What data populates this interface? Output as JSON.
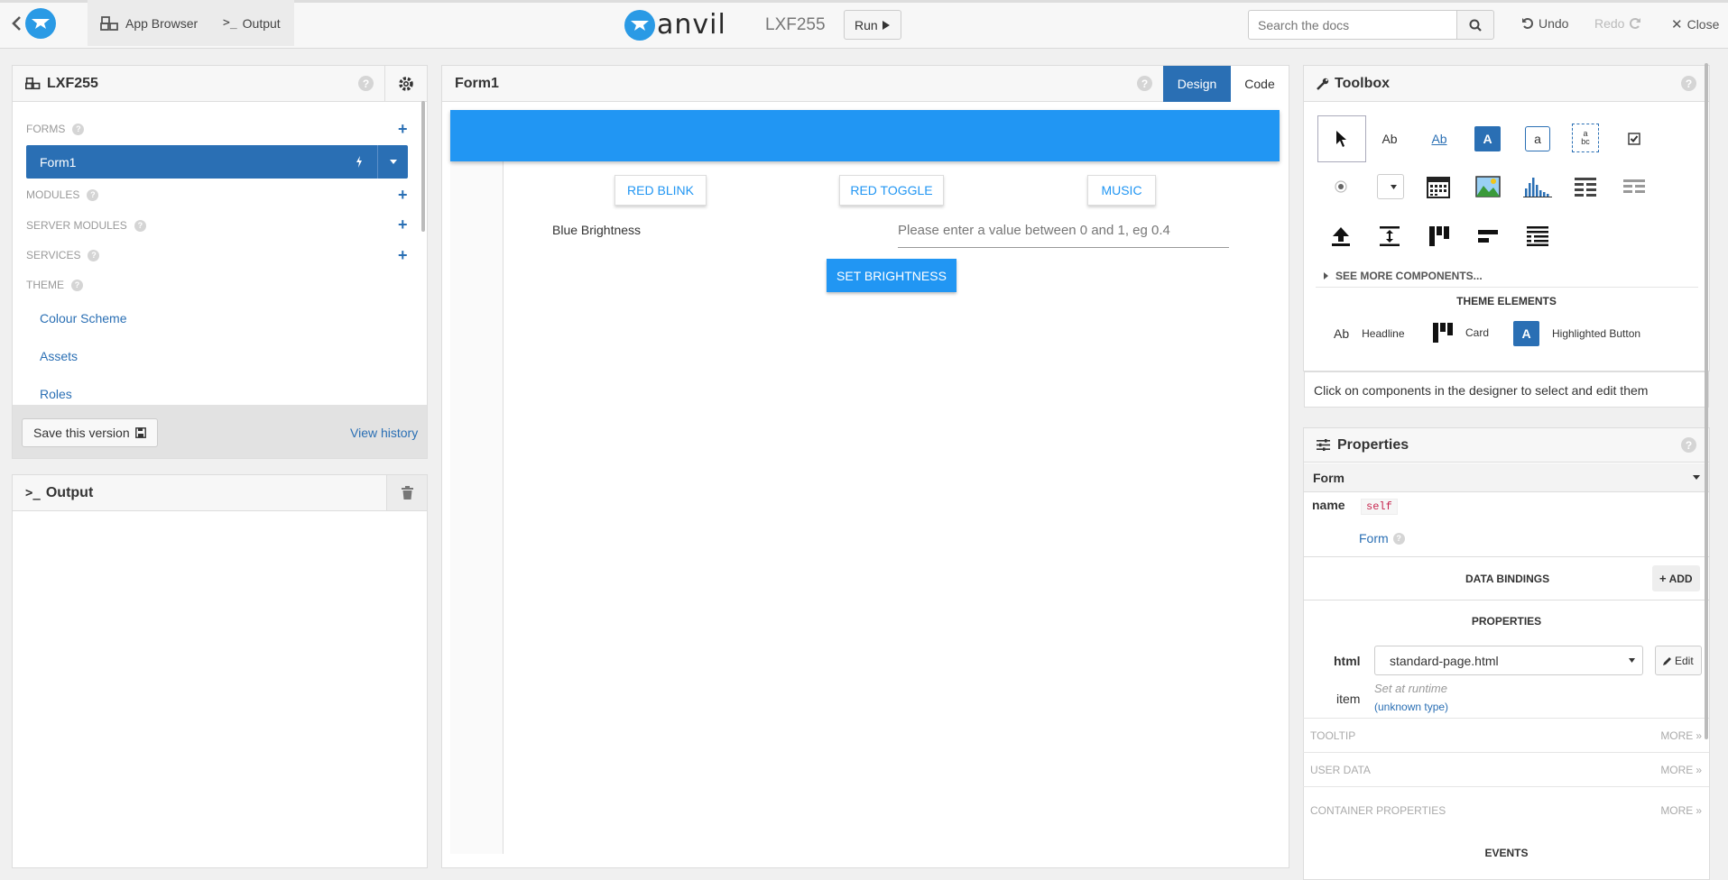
{
  "topbar": {
    "app_browser": "App Browser",
    "output": "Output",
    "brand": "anvil",
    "app_name": "LXF255",
    "run": "Run",
    "search_placeholder": "Search the docs",
    "undo": "Undo",
    "redo": "Redo",
    "close": "Close"
  },
  "app_panel": {
    "title": "LXF255",
    "sections": {
      "forms": "FORMS",
      "modules": "MODULES",
      "server_modules": "SERVER MODULES",
      "services": "SERVICES",
      "theme": "THEME"
    },
    "form_item": "Form1",
    "theme_items": [
      "Colour Scheme",
      "Assets",
      "Roles"
    ],
    "save_version": "Save this version",
    "view_history": "View history"
  },
  "output_panel": {
    "title": "Output"
  },
  "designer": {
    "title": "Form1",
    "tab_design": "Design",
    "tab_code": "Code",
    "buttons": [
      "RED BLINK",
      "RED TOGGLE",
      "MUSIC"
    ],
    "label": "Blue Brightness",
    "input_placeholder": "Please enter a value between 0 and 1, eg 0.4",
    "set_button": "SET BRIGHTNESS",
    "header_color": "#2196f3"
  },
  "toolbox": {
    "title": "Toolbox",
    "see_more": "SEE MORE COMPONENTS...",
    "theme_elements": "THEME ELEMENTS",
    "theme_items": [
      "Headline",
      "Card",
      "Highlighted Button"
    ],
    "hint": "Click on components in the designer to select and edit them",
    "tool_text": {
      "label": "Ab",
      "link": "Ab",
      "button": "A",
      "textbox": "a",
      "textarea_top": "a",
      "textarea_bottom": "bc",
      "headline_icon": "Ab",
      "hbutton_icon": "A"
    }
  },
  "properties": {
    "title": "Properties",
    "dropdown": "Form",
    "name_label": "name",
    "name_value": "self",
    "form_link": "Form",
    "data_bindings": "DATA BINDINGS",
    "add": "ADD",
    "properties_header": "PROPERTIES",
    "html_label": "html",
    "html_value": "standard-page.html",
    "edit": "Edit",
    "item_label": "item",
    "item_value": "Set at runtime",
    "item_type": "(unknown type)",
    "tooltip": "TOOLTIP",
    "user_data": "USER DATA",
    "container_properties": "CONTAINER PROPERTIES",
    "more": "MORE",
    "events": "EVENTS"
  },
  "colors": {
    "accent": "#2a6fb4",
    "material_blue": "#2196f3"
  }
}
